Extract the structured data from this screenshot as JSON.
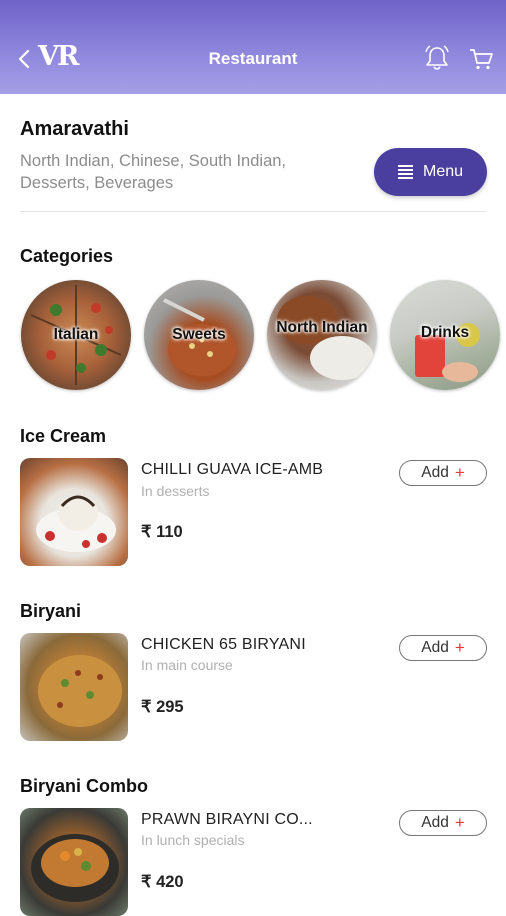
{
  "header": {
    "logo_text": "VR",
    "title": "Restaurant"
  },
  "restaurant": {
    "name": "Amaravathi",
    "cuisines": "North Indian, Chinese, South Indian, Desserts, Beverages",
    "menu_label": "Menu"
  },
  "categories": {
    "title": "Categories",
    "items": [
      {
        "label": "Italian"
      },
      {
        "label": "Sweets"
      },
      {
        "label": "North Indian"
      },
      {
        "label": "Drinks"
      }
    ]
  },
  "sections": [
    {
      "title": "Ice Cream",
      "item": {
        "name": "CHILLI GUAVA ICE-AMB",
        "sub": "In desserts",
        "price": "₹ 110",
        "add_label": "Add"
      }
    },
    {
      "title": "Biryani",
      "item": {
        "name": "CHICKEN 65 BIRYANI",
        "sub": "In main course",
        "price": "₹ 295",
        "add_label": "Add"
      }
    },
    {
      "title": "Biryani Combo",
      "item": {
        "name": "PRAWN BIRAYNI CO...",
        "sub": "In lunch specials",
        "price": "₹ 420",
        "add_label": "Add"
      }
    }
  ],
  "icons": {
    "back": "chevron-left-icon",
    "bell": "bell-icon",
    "cart": "cart-icon",
    "menu": "hamburger-icon",
    "plus": "+"
  },
  "colors": {
    "header_top": "#6f63c9",
    "header_bottom": "#a59fe6",
    "menu_button": "#4a3f9e",
    "add_plus": "#e53935"
  }
}
